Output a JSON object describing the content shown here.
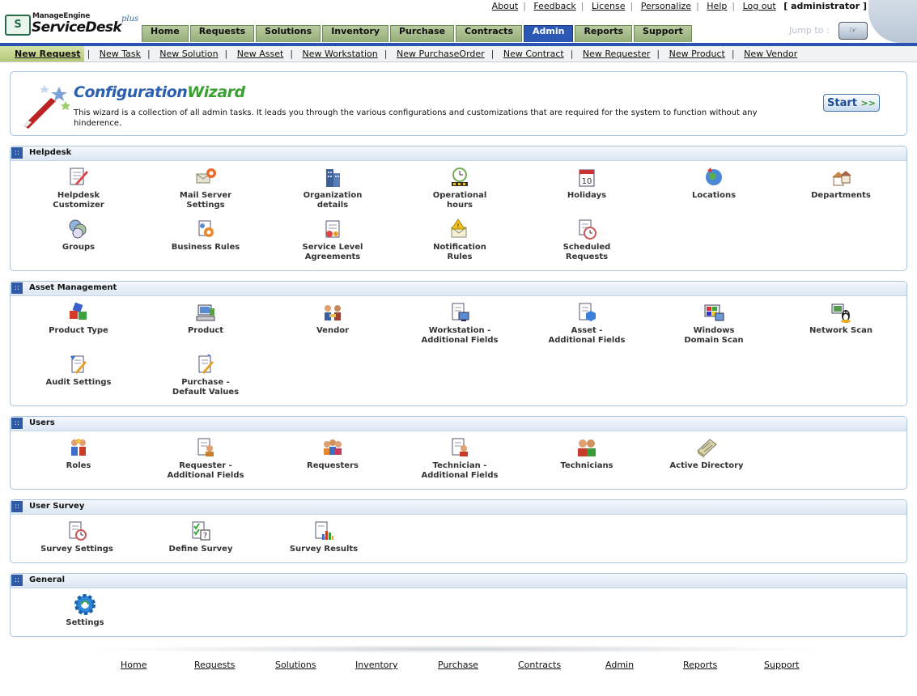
{
  "header": {
    "brand_top": "ManageEngine",
    "brand_main": "ServiceDesk",
    "brand_plus": "plus",
    "top_links": [
      "About",
      "Feedback",
      "License",
      "Personalize",
      "Help",
      "Log out"
    ],
    "user": "[ administrator ]",
    "jump_to": "Jump to :",
    "tabs": [
      "Home",
      "Requests",
      "Solutions",
      "Inventory",
      "Purchase",
      "Contracts",
      "Admin",
      "Reports",
      "Support"
    ],
    "active_tab": "Admin"
  },
  "subnav": [
    "New Request",
    "New Task",
    "New Solution",
    "New Asset",
    "New Workstation",
    "New PurchaseOrder",
    "New Contract",
    "New Requester",
    "New Product",
    "New Vendor"
  ],
  "wizard": {
    "title_a": "Configuration",
    "title_b": "Wizard",
    "description": "This wizard is a collection of all admin tasks. It leads you through the various configurations and customizations that are required for the system to function without any hinderence.",
    "start_label": "Start",
    "start_chevrons": ">>"
  },
  "sections": {
    "helpdesk": {
      "title": "Helpdesk",
      "items": [
        "Helpdesk\nCustomizer",
        "Mail Server\nSettings",
        "Organization\ndetails",
        "Operational\nhours",
        "Holidays",
        "Locations",
        "Departments",
        "Groups",
        "Business Rules",
        "Service Level\nAgreements",
        "Notification\nRules",
        "Scheduled\nRequests"
      ]
    },
    "asset": {
      "title": "Asset Management",
      "items": [
        "Product Type",
        "Product",
        "Vendor",
        "Workstation -\nAdditional Fields",
        "Asset -\nAdditional Fields",
        "Windows\nDomain Scan",
        "Network Scan",
        "Audit Settings",
        "Purchase -\nDefault Values"
      ]
    },
    "users": {
      "title": "Users",
      "items": [
        "Roles",
        "Requester -\nAdditional Fields",
        "Requesters",
        "Technician -\nAdditional Fields",
        "Technicians",
        "Active Directory"
      ]
    },
    "survey": {
      "title": "User Survey",
      "items": [
        "Survey Settings",
        "Define Survey",
        "Survey Results"
      ]
    },
    "general": {
      "title": "General",
      "items": [
        "Settings"
      ]
    }
  },
  "footer": [
    "Home",
    "Requests",
    "Solutions",
    "Inventory",
    "Purchase",
    "Contracts",
    "Admin",
    "Reports",
    "Support"
  ],
  "colors": {
    "tab_active": "#2b57b5",
    "tab": "#a3ba86",
    "wizard_title": "#2c5fb0",
    "wizard_title_accent": "#3aa030",
    "section_border": "#a9c4dc"
  }
}
